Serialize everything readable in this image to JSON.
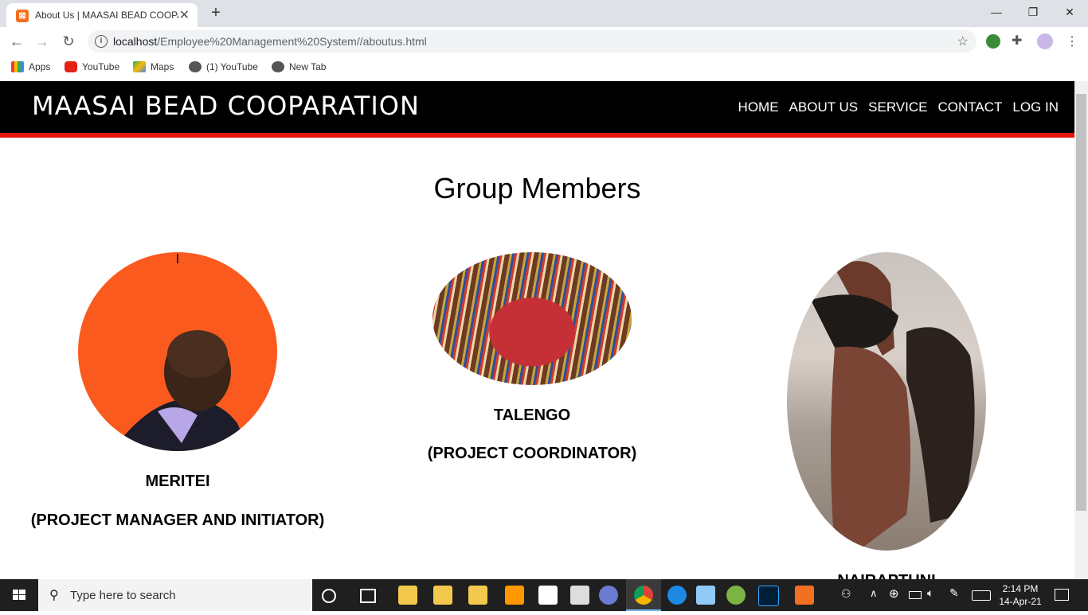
{
  "browser": {
    "tab_title": "About Us | MAASAI BEAD COOPARATION",
    "url_host": "localhost",
    "url_path": "/Employee%20Management%20System//aboutus.html",
    "bookmarks": [
      "Apps",
      "YouTube",
      "Maps",
      "(1) YouTube",
      "New Tab"
    ]
  },
  "site": {
    "brand": "MAASAI BEAD COOPARATION",
    "nav": [
      "HOME",
      "ABOUT US",
      "SERVICE",
      "CONTACT",
      "LOG IN"
    ]
  },
  "main": {
    "heading": "Group Members",
    "members": [
      {
        "name": "MERITEI",
        "role": "(PROJECT MANAGER AND INITIATOR)"
      },
      {
        "name": "TALENGO",
        "role": "(PROJECT COORDINATOR)"
      },
      {
        "name": "NAIRAPTUNI",
        "role": ""
      }
    ]
  },
  "taskbar": {
    "search_placeholder": "Type here to search",
    "time": "2:14 PM",
    "date": "14-Apr-21"
  },
  "colors": {
    "header_bg": "#000000",
    "header_border": "#e4150b",
    "avatar1_bg": "#fb5a1f"
  }
}
